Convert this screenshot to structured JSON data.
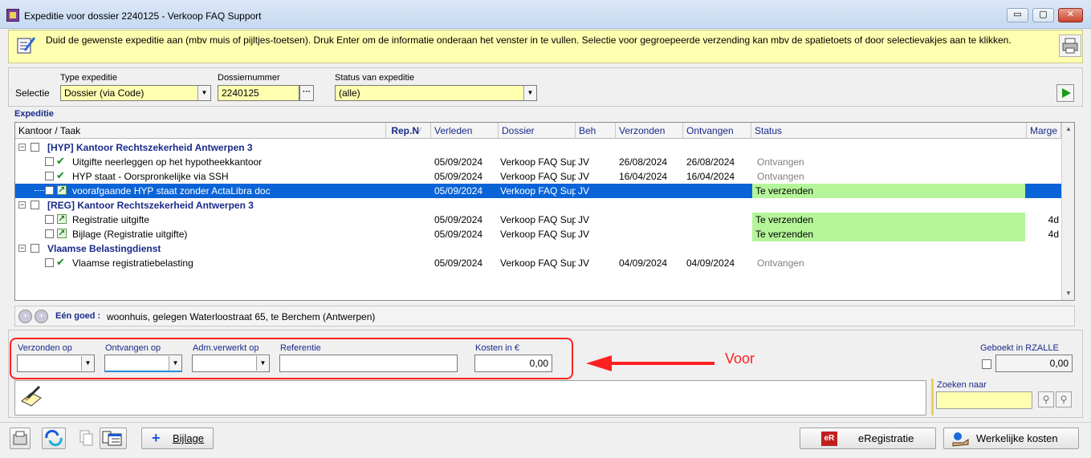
{
  "window": {
    "title": "Expeditie voor dossier 2240125 - Verkoop FAQ Support",
    "minimize": "▭",
    "maximize": "▢",
    "close": "✕"
  },
  "info": {
    "text": "Duid de gewenste expeditie aan (mbv muis of pijltjes-toetsen). Druk Enter om de informatie onderaan het venster in te vullen. Selectie voor gegroepeerde verzending kan mbv de spatietoets of door selectievakjes aan te klikken."
  },
  "selection": {
    "label": "Selectie",
    "type_label": "Type expeditie",
    "type_value": "Dossier (via Code)",
    "dossier_label": "Dossiernummer",
    "dossier_value": "2240125",
    "dossier_btn": "···",
    "status_label": "Status van expeditie",
    "status_value": "(alle)"
  },
  "grid": {
    "title": "Expeditie",
    "columns": {
      "kantoor": "Kantoor / Taak",
      "repn": "Rep.N",
      "verleden": "Verleden",
      "dossier": "Dossier",
      "beh": "Beh",
      "verzonden": "Verzonden",
      "ontvangen": "Ontvangen",
      "status": "Status",
      "marge": "Marge"
    },
    "groups": [
      {
        "title": "[HYP] Kantoor Rechtszekerheid Antwerpen 3"
      },
      {
        "title": "[REG] Kantoor Rechtszekerheid Antwerpen 3"
      },
      {
        "title": "Vlaamse Belastingdienst"
      }
    ],
    "rows": [
      {
        "task": "Uitgifte neerleggen op het hypotheekkantoor",
        "verleden": "05/09/2024",
        "dossier": "Verkoop FAQ Sup",
        "beh": "JV",
        "verzonden": "26/08/2024",
        "ontvangen": "26/08/2024",
        "status": "Ontvangen",
        "marge": ""
      },
      {
        "task": "HYP staat - Oorspronkelijke via SSH",
        "verleden": "05/09/2024",
        "dossier": "Verkoop FAQ Sup",
        "beh": "JV",
        "verzonden": "16/04/2024",
        "ontvangen": "16/04/2024",
        "status": "Ontvangen",
        "marge": ""
      },
      {
        "task": "voorafgaande HYP staat zonder ActaLibra doc",
        "verleden": "05/09/2024",
        "dossier": "Verkoop FAQ Sup",
        "beh": "JV",
        "verzonden": "",
        "ontvangen": "",
        "status": "Te verzenden",
        "marge": ""
      },
      {
        "task": "Registratie uitgifte",
        "verleden": "05/09/2024",
        "dossier": "Verkoop FAQ Sup",
        "beh": "JV",
        "verzonden": "",
        "ontvangen": "",
        "status": "Te verzenden",
        "marge": "4d"
      },
      {
        "task": "Bijlage (Registratie uitgifte)",
        "verleden": "05/09/2024",
        "dossier": "Verkoop FAQ Sup",
        "beh": "JV",
        "verzonden": "",
        "ontvangen": "",
        "status": "Te verzenden",
        "marge": "4d"
      },
      {
        "task": "Vlaamse registratiebelasting",
        "verleden": "05/09/2024",
        "dossier": "Verkoop FAQ Sup",
        "beh": "JV",
        "verzonden": "04/09/2024",
        "ontvangen": "04/09/2024",
        "status": "Ontvangen",
        "marge": ""
      }
    ]
  },
  "goed": {
    "label": "Eén goed :",
    "value": "woonhuis, gelegen Waterloostraat 65, te Berchem (Antwerpen)"
  },
  "details": {
    "verzonden_label": "Verzonden op",
    "ontvangen_label": "Ontvangen op",
    "adm_label": "Adm.verwerkt op",
    "referentie_label": "Referentie",
    "kosten_label": "Kosten in €",
    "kosten_value": "0,00",
    "geboekt_label": "Geboekt in RZALLE",
    "geboekt_value": "0,00",
    "zoeken_label": "Zoeken naar",
    "annotation": "Voor"
  },
  "toolbar": {
    "bijlage": "Bijlage",
    "eregistratie": "eRegistratie",
    "eregistratie_badge": "eR",
    "werkelijke": "Werkelijke kosten"
  },
  "colors": {
    "selected_row": "#0a64d8",
    "status_green": "#b5f59a",
    "highlight_yellow": "#ffffb0",
    "annotation_red": "#ff2020"
  }
}
